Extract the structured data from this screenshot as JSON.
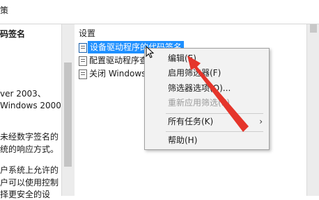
{
  "title_bar": {
    "partial_title": "策"
  },
  "left_pane": {
    "lines": [
      {
        "text": "码签名",
        "bold": true
      },
      {
        "text": "ver 2003、",
        "bold": false
      },
      {
        "text": "Windows 2000",
        "bold": false
      },
      {
        "text": "未经数字签名的",
        "bold": false
      },
      {
        "text": "统的响应方式。",
        "bold": false
      },
      {
        "text": "户系统上允许的",
        "bold": false
      },
      {
        "text": "户可以使用控制",
        "bold": false
      },
      {
        "text": "择更安全的设",
        "bold": false
      }
    ]
  },
  "list": {
    "column_header": "设置",
    "rows": [
      {
        "label": "设备驱动程序的代码签名",
        "selected": true
      },
      {
        "label": "配置驱动程序查",
        "selected": false
      },
      {
        "label": "关闭 Windows",
        "selected": false
      }
    ]
  },
  "context_menu": {
    "items": [
      {
        "label": "编辑(E)",
        "disabled": false,
        "submenu": false
      },
      {
        "label": "启用筛选器(F)",
        "disabled": false,
        "submenu": false
      },
      {
        "label": "筛选器选项(O)...",
        "disabled": false,
        "submenu": false
      },
      {
        "label": "重新应用筛选(E)",
        "disabled": true,
        "submenu": false
      },
      {
        "label": "所有任务(K)",
        "disabled": false,
        "submenu": true
      },
      {
        "label": "帮助(H)",
        "disabled": false,
        "submenu": false
      }
    ]
  },
  "colors": {
    "selection": "#1e90ff",
    "annotation_arrow": "#e5352b",
    "menu_background": "#f2f2f2"
  },
  "icons": [
    "policy-setting-icon",
    "mouse-pointer-icon",
    "submenu-arrow-icon",
    "annotation-arrow"
  ]
}
